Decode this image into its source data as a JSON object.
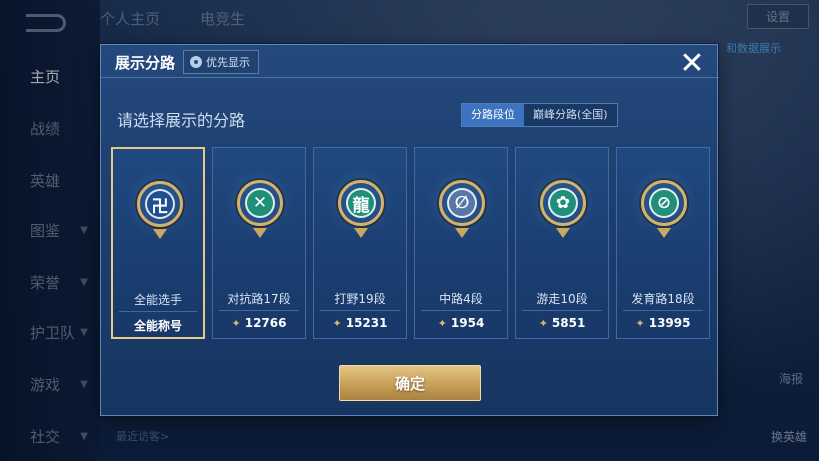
{
  "background": {
    "top_tabs": [
      "个人主页",
      "电竞生"
    ],
    "mode_button": "设置",
    "link_text": "和数据展示",
    "right_side_label": "海报",
    "hero_switch": "换英雄",
    "bottom_text": "最近访客>"
  },
  "nav": {
    "items": [
      {
        "label": "主页",
        "active": true,
        "arrow": false
      },
      {
        "label": "战绩",
        "active": false,
        "arrow": false
      },
      {
        "label": "英雄",
        "active": false,
        "arrow": false
      },
      {
        "label": "图鉴",
        "active": false,
        "arrow": true
      },
      {
        "label": "荣誉",
        "active": false,
        "arrow": true
      },
      {
        "label": "护卫队",
        "active": false,
        "arrow": true
      },
      {
        "label": "游戏",
        "active": false,
        "arrow": true
      },
      {
        "label": "社交",
        "active": false,
        "arrow": true
      }
    ]
  },
  "dialog": {
    "title": "展示分路",
    "pref_button": "优先显示",
    "close_icon": "✕",
    "subtitle": "请选择展示的分路",
    "segments": [
      {
        "label": "分路段位",
        "active": true
      },
      {
        "label": "巅峰分路(全国)",
        "active": false
      }
    ],
    "cards": [
      {
        "label": "全能选手",
        "value": "全能称号",
        "selected": true,
        "color": "#1e4f93",
        "glyph": "卍",
        "show_icon": false
      },
      {
        "label": "对抗路17段",
        "value": "12766",
        "selected": false,
        "color": "#1f8f7a",
        "glyph": "✕",
        "show_icon": true
      },
      {
        "label": "打野19段",
        "value": "15231",
        "selected": false,
        "color": "#1f8f7a",
        "glyph": "龍",
        "show_icon": true
      },
      {
        "label": "中路4段",
        "value": "1954",
        "selected": false,
        "color": "#5578a8",
        "glyph": "∅",
        "show_icon": true
      },
      {
        "label": "游走10段",
        "value": "5851",
        "selected": false,
        "color": "#1f8f7a",
        "glyph": "✿",
        "show_icon": true
      },
      {
        "label": "发育路18段",
        "value": "13995",
        "selected": false,
        "color": "#1f8f7a",
        "glyph": "⊘",
        "show_icon": true
      }
    ],
    "confirm": "确定"
  }
}
